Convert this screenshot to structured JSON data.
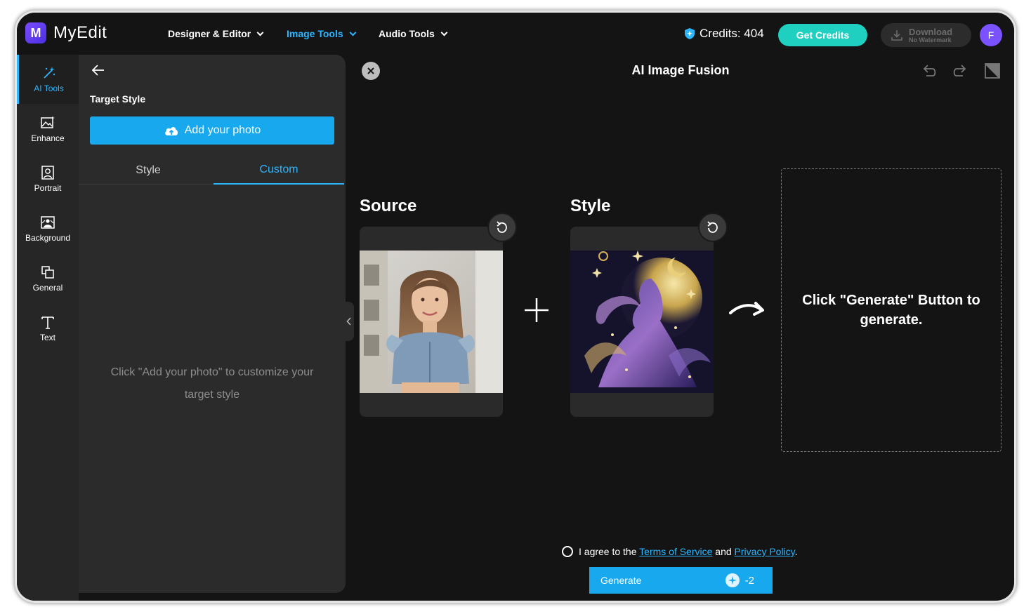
{
  "app": {
    "name": "MyEdit",
    "logo_letter": "M"
  },
  "nav": [
    {
      "label": "Designer & Editor",
      "active": false
    },
    {
      "label": "Image Tools",
      "active": true
    },
    {
      "label": "Audio Tools",
      "active": false
    }
  ],
  "credits": {
    "label": "Credits: 404"
  },
  "get_credits": "Get Credits",
  "download": {
    "label": "Download",
    "sub": "No Watermark"
  },
  "user": {
    "initial": "F"
  },
  "rail": [
    {
      "label": "AI Tools",
      "icon": "magic-wand-icon",
      "active": true
    },
    {
      "label": "Enhance",
      "icon": "enhance-image-icon",
      "active": false
    },
    {
      "label": "Portrait",
      "icon": "portrait-icon",
      "active": false
    },
    {
      "label": "Background",
      "icon": "background-icon",
      "active": false
    },
    {
      "label": "General",
      "icon": "general-icon",
      "active": false
    },
    {
      "label": "Text",
      "icon": "text-icon",
      "active": false
    }
  ],
  "panel": {
    "title": "Target Style",
    "add_photo": "Add your photo",
    "tabs": [
      {
        "label": "Style",
        "active": false
      },
      {
        "label": "Custom",
        "active": true
      }
    ],
    "hint_line1": "Click \"Add your photo\" to customize your",
    "hint_line2": "target style"
  },
  "main": {
    "title": "AI Image Fusion",
    "source_label": "Source",
    "style_label": "Style",
    "result_line1": "Click \"Generate\" Button to",
    "result_line2": "generate.",
    "agree_prefix": "I agree to the",
    "terms": "Terms of Service",
    "and": "and",
    "privacy": "Privacy Policy",
    "period": ".",
    "generate": "Generate",
    "cost": "-2"
  },
  "colors": {
    "accent": "#2bb6ff",
    "button": "#18a8ee",
    "credits_button": "#1fd0c0",
    "avatar": "#7a52ff"
  }
}
